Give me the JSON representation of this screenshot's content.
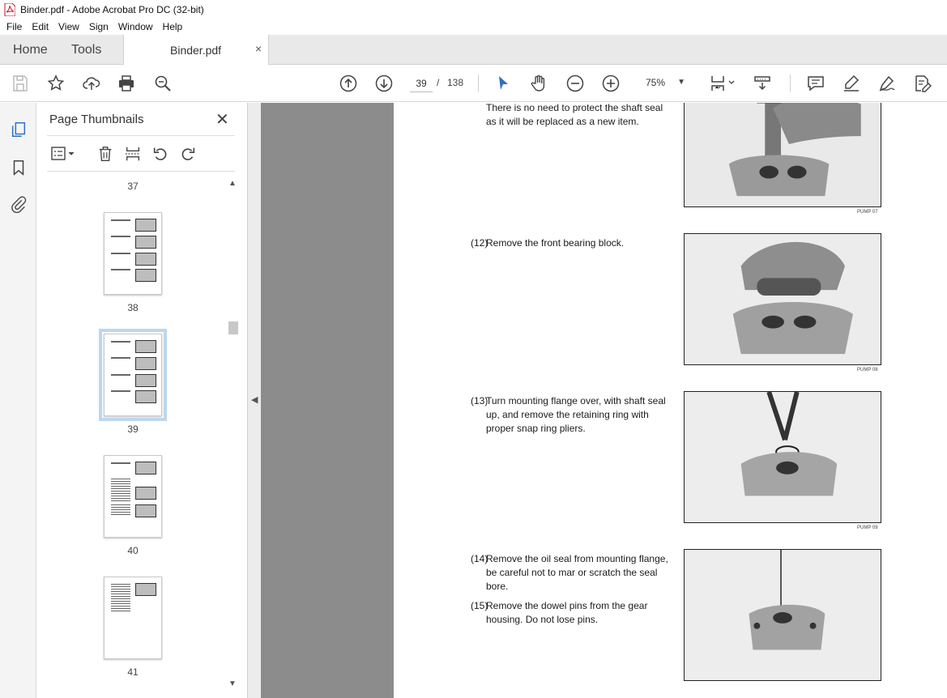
{
  "window": {
    "title": "Binder.pdf - Adobe Acrobat Pro DC (32-bit)"
  },
  "menu": [
    "File",
    "Edit",
    "View",
    "Sign",
    "Window",
    "Help"
  ],
  "tabs": {
    "home": "Home",
    "tools": "Tools",
    "document": "Binder.pdf",
    "close_glyph": "×"
  },
  "toolbar": {
    "current_page": "39",
    "page_separator": "/",
    "total_pages": "138",
    "zoom": "75%"
  },
  "sidebar": {
    "title": "Page Thumbnails",
    "close_glyph": "✕",
    "pages": [
      {
        "label": "37"
      },
      {
        "label": "38"
      },
      {
        "label": "39",
        "selected": true
      },
      {
        "label": "40"
      },
      {
        "label": "41"
      }
    ]
  },
  "document": {
    "blocks": [
      {
        "number": "",
        "text": "There is no need to protect the shaft seal as it will be replaced as a new item.",
        "lines": [
          "There is no need to protect the shaft seal",
          "as it will be replaced as a new item."
        ]
      },
      {
        "number": "(12)",
        "lines": [
          "Remove the front bearing block."
        ]
      },
      {
        "number": "(13)",
        "lines": [
          "Turn mounting flange over, with shaft seal",
          "up, and remove the retaining ring with",
          "proper snap ring pliers."
        ]
      },
      {
        "number": "(14)",
        "lines": [
          "Remove the oil seal from mounting flange,",
          "be careful not to mar or scratch the seal",
          "bore."
        ]
      },
      {
        "number": "(15)",
        "lines": [
          "Remove the dowel pins from the gear",
          "housing.  Do not lose pins."
        ]
      }
    ],
    "captions": [
      "PUMP 07",
      "PUMP 08",
      "PUMP 09"
    ]
  },
  "icons": [
    "save-icon",
    "star-icon",
    "upload-icon",
    "print-icon",
    "search-zoom-icon",
    "arrow-up-icon",
    "arrow-down-icon",
    "select-cursor-icon",
    "hand-icon",
    "zoom-out-icon",
    "zoom-in-icon",
    "fit-page-icon",
    "scroll-mode-icon",
    "comment-icon",
    "highlight-icon",
    "sign-icon",
    "edit-pdf-icon",
    "thumbnails-icon",
    "bookmark-icon",
    "attachment-icon",
    "options-icon",
    "delete-icon",
    "insert-icon",
    "rotate-ccw-icon",
    "rotate-cw-icon"
  ]
}
